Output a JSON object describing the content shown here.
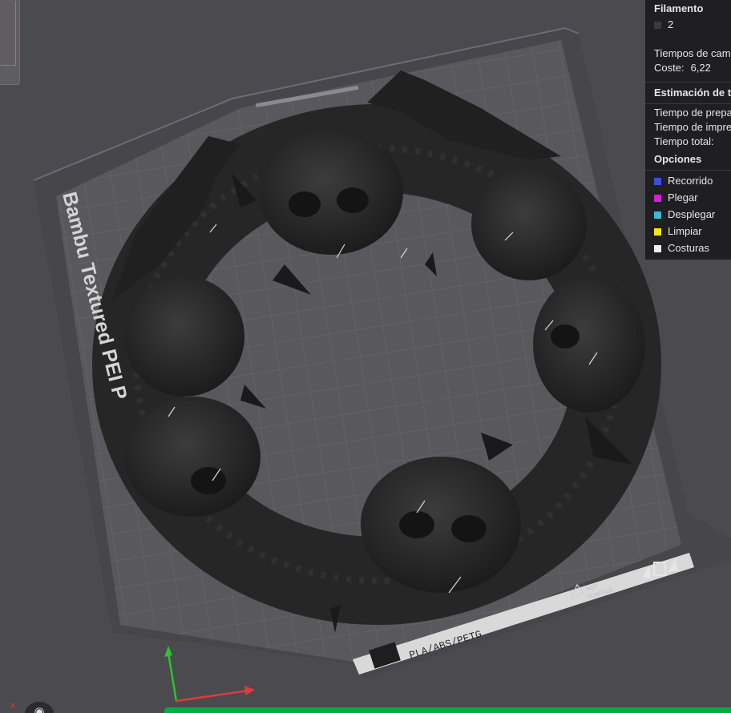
{
  "panel": {
    "filament_title": "Filamento",
    "filament_item": "2",
    "times_label": "Tiempos de cam",
    "cost_label": "Coste:",
    "cost_value": "6,22",
    "estimation_title": "Estimación de ti",
    "prep_time_label": "Tiempo de prepa",
    "print_time_label": "Tiempo de impre",
    "total_time_label": "Tiempo total:",
    "options_title": "Opciones",
    "options": [
      {
        "label": "Recorrido",
        "color": "#3b4fd4"
      },
      {
        "label": "Plegar",
        "color": "#d31fd6"
      },
      {
        "label": "Desplegar",
        "color": "#3fb6d6"
      },
      {
        "label": "Limpiar",
        "color": "#f5e51b"
      },
      {
        "label": "Costuras",
        "color": "#f0f0f0"
      }
    ],
    "filament_color": "#3a3a3a"
  },
  "plate": {
    "brand_text": "Bambu Textured PEI P",
    "material_text": "PLA/ABS/PETG",
    "hot_surface_line1": "HOT",
    "hot_surface_line2": "SURFACE"
  },
  "axes": {
    "x_label": "X"
  },
  "colors": {
    "accent_green": "#00ae42",
    "axis_x": "#e23a3a",
    "axis_y": "#2ec22e"
  }
}
